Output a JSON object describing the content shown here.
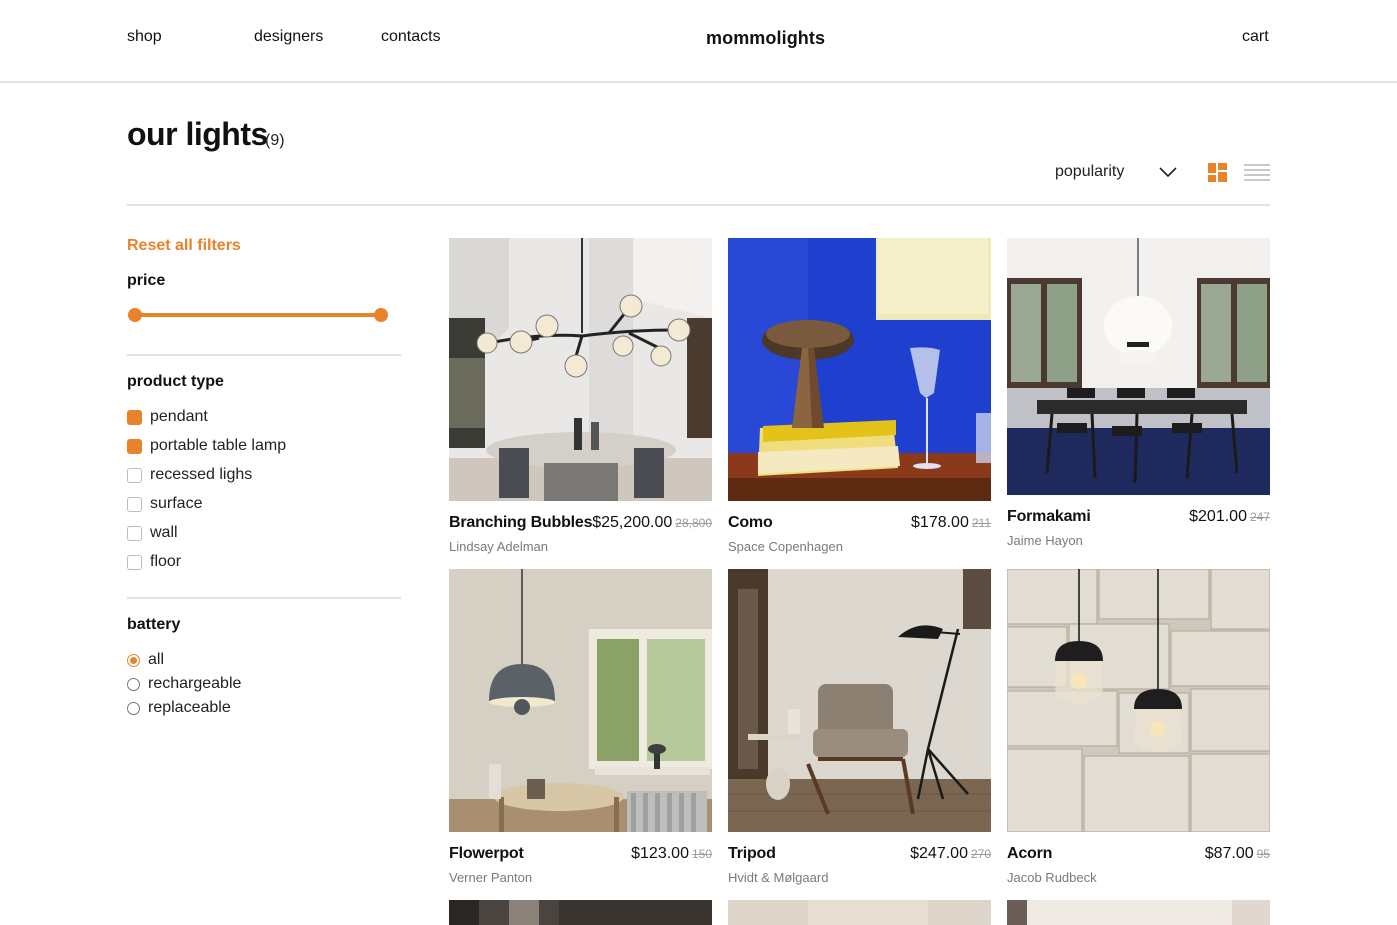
{
  "header": {
    "nav": [
      "shop",
      "designers",
      "contacts"
    ],
    "logo": "mommolights",
    "cart": "cart"
  },
  "catalog": {
    "title": "our lights",
    "count": "(9)",
    "sort": "popularity"
  },
  "colors": {
    "accent": "#e8832a",
    "divider": "#e4e3de",
    "muted": "#7a7a7a"
  },
  "filters": {
    "reset_label": "Reset all filters",
    "price": {
      "heading": "price",
      "range_min_fraction": 0,
      "range_max_fraction": 1
    },
    "product_type": {
      "heading": "product type",
      "options": [
        {
          "label": "pendant",
          "checked": true
        },
        {
          "label": "portable table lamp",
          "checked": true
        },
        {
          "label": "recessed lighs",
          "checked": false
        },
        {
          "label": "surface",
          "checked": false
        },
        {
          "label": "wall",
          "checked": false
        },
        {
          "label": "floor",
          "checked": false
        }
      ]
    },
    "battery": {
      "heading": "battery",
      "options": [
        {
          "label": "all",
          "selected": true
        },
        {
          "label": "rechargeable",
          "selected": false
        },
        {
          "label": "replaceable",
          "selected": false
        }
      ]
    }
  },
  "products": [
    {
      "name": "Branching Bubbles",
      "price": "$25,200.00",
      "old_price": "28,800",
      "designer": "Lindsay Adelman",
      "image": "chandelier-dining-room"
    },
    {
      "name": "Como",
      "price": "$178.00",
      "old_price": "211",
      "designer": "Space Copenhagen",
      "image": "table-lamp-blue-wall"
    },
    {
      "name": "Formakami",
      "price": "$201.00",
      "old_price": "247",
      "designer": "Jaime Hayon",
      "image": "paper-pendant-dining"
    },
    {
      "name": "Flowerpot",
      "price": "$123.00",
      "old_price": "150",
      "designer": "Verner Panton",
      "image": "dome-pendant-kitchen"
    },
    {
      "name": "Tripod",
      "price": "$247.00",
      "old_price": "270",
      "designer": "Hvidt & Mølgaard",
      "image": "floor-lamp-armchair"
    },
    {
      "name": "Acorn",
      "price": "$87.00",
      "old_price": "95",
      "designer": "Jacob Rudbeck",
      "image": "glass-pendants-stone-wall"
    }
  ],
  "icons": {
    "sort": "chevron-down-icon",
    "grid_view": "grid-view-icon",
    "list_view": "list-view-icon"
  }
}
